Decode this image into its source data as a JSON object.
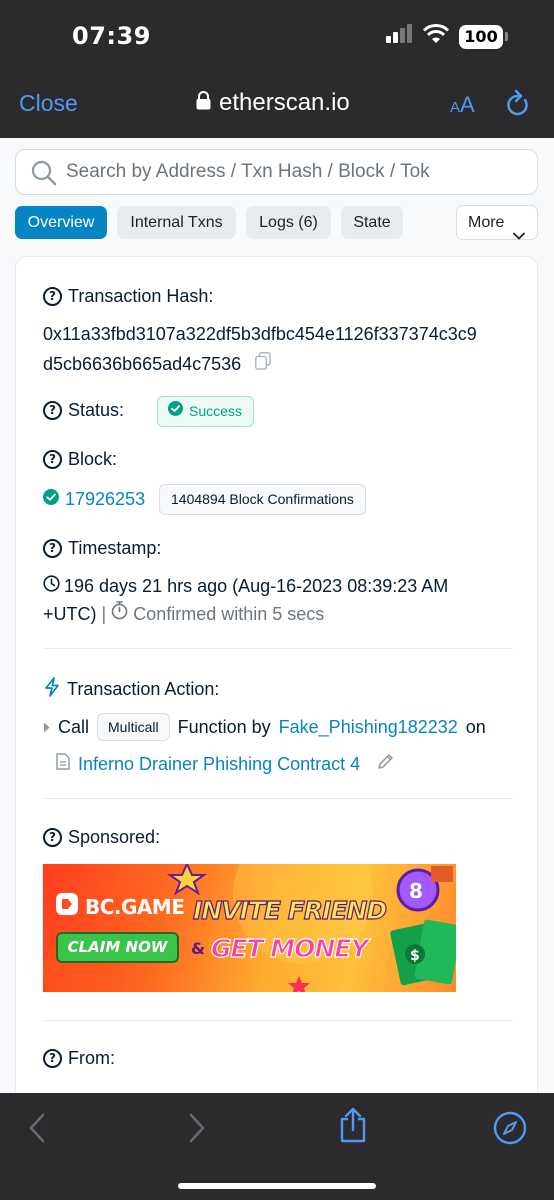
{
  "status_bar": {
    "time": "07:39",
    "battery": "100"
  },
  "browser": {
    "close_label": "Close",
    "url": "etherscan.io",
    "text_size_label": "AA"
  },
  "search": {
    "placeholder": "Search by Address / Txn Hash / Block / Tok"
  },
  "tabs": [
    {
      "label": "Overview",
      "active": true
    },
    {
      "label": "Internal Txns",
      "active": false
    },
    {
      "label": "Logs (6)",
      "active": false
    },
    {
      "label": "State",
      "active": false
    }
  ],
  "more_label": "More",
  "tx": {
    "hash_label": "Transaction Hash:",
    "hash_line1": "0x11a33fbd3107a322df5b3dfbc454e1126f337374c3c9",
    "hash_line2": "d5cb6636b665ad4c7536",
    "status_label": "Status:",
    "status_value": "Success",
    "block_label": "Block:",
    "block_number": "17926253",
    "block_confirmations": "1404894 Block Confirmations",
    "timestamp_label": "Timestamp:",
    "timestamp_line1": "196 days 21 hrs ago (Aug-16-2023 08:39:23 AM",
    "timestamp_line2": "+UTC)",
    "confirmed_within": "Confirmed within 5 secs",
    "action_label": "Transaction Action:",
    "action_call": "Call",
    "action_method": "Multicall",
    "action_function_by": "Function by",
    "action_caller": "Fake_Phishing182232",
    "action_on": "on",
    "action_contract": "Inferno Drainer Phishing Contract 4",
    "sponsored_label": "Sponsored:",
    "from_label": "From:"
  },
  "ad": {
    "brand": "BC.GAME",
    "headline1": "INVITE FRIEND",
    "connector": "&",
    "headline2": "GET MONEY",
    "cta": "CLAIM NOW"
  },
  "colors": {
    "accent": "#0784c3",
    "success": "#00a186",
    "ios_blue": "#4e9bf0"
  }
}
